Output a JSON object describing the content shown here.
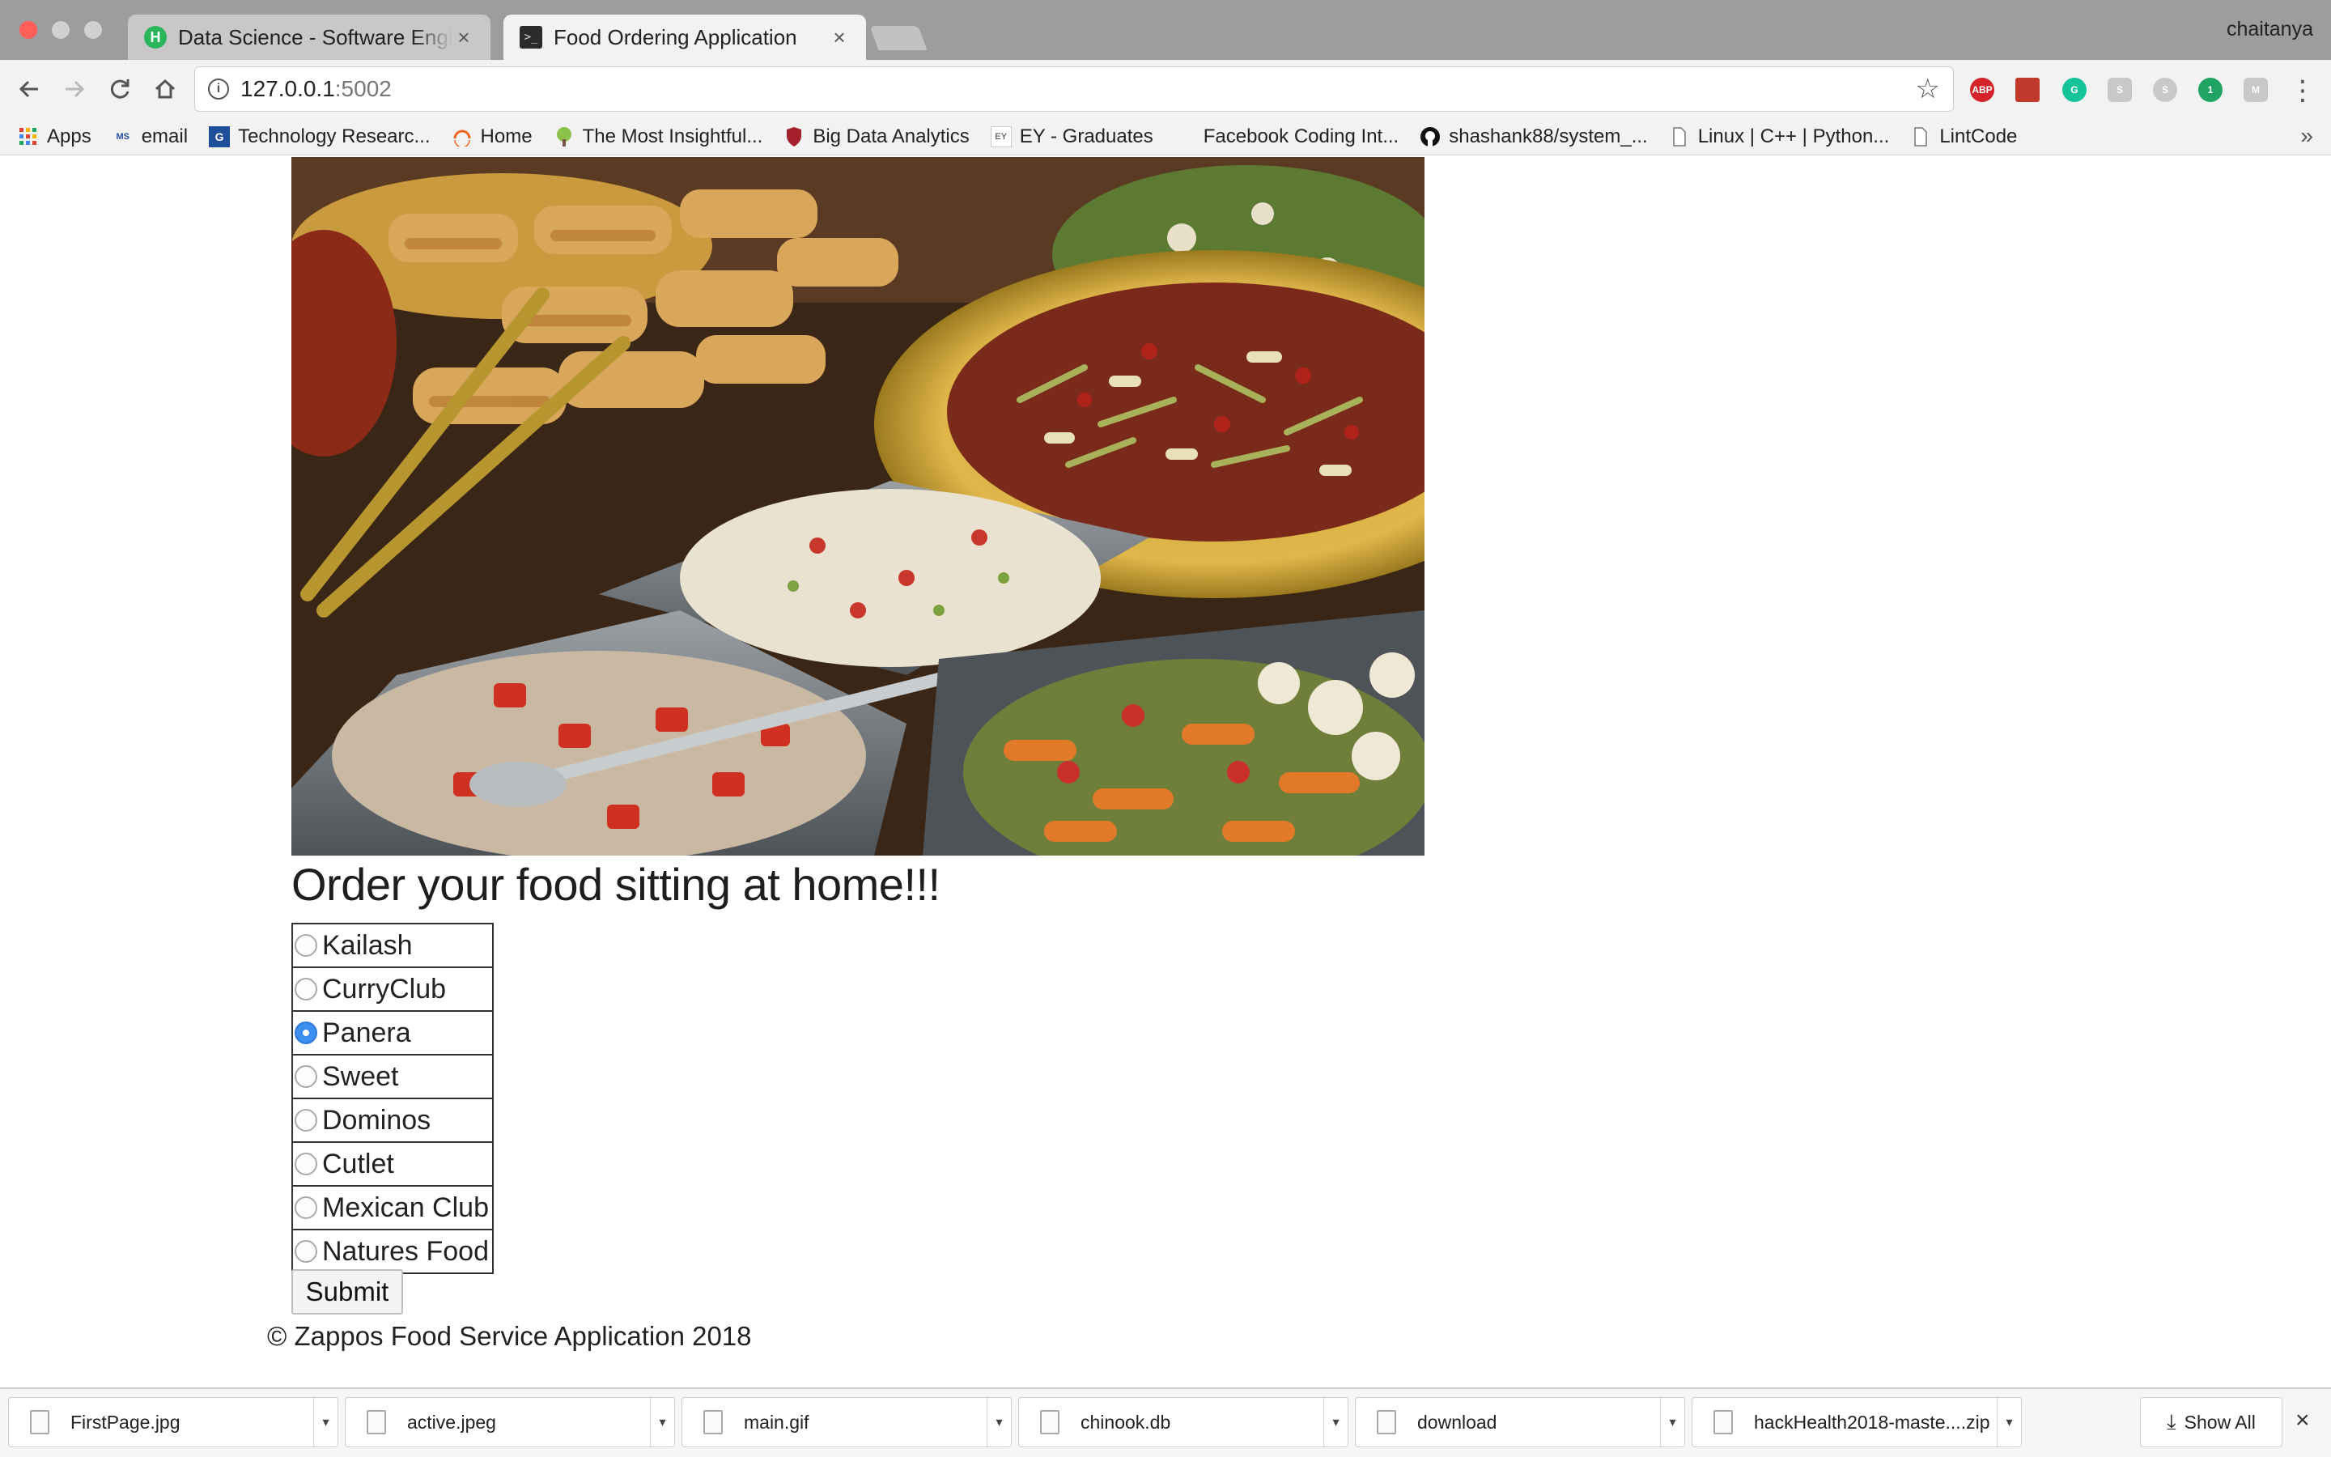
{
  "browser": {
    "tabs": [
      {
        "title": "Data Science - Software Engin",
        "favicon": "H"
      },
      {
        "title": "Food Ordering Application",
        "favicon": ">_"
      }
    ],
    "profile_name": "chaitanya",
    "tab_close_glyph": "×",
    "url_host": "127.0.0.1",
    "url_port": ":5002",
    "info_glyph": "i",
    "extensions": [
      {
        "label": "ABP",
        "color": "#d4232a"
      },
      {
        "label": "",
        "color": "#c0392b"
      },
      {
        "label": "G",
        "color": "#15c39a"
      },
      {
        "label": "S",
        "color": "#c8c8c8"
      },
      {
        "label": "S",
        "color": "#c8c8c8"
      },
      {
        "label": "1",
        "color": "#1fa463"
      },
      {
        "label": "M",
        "color": "#c8c8c8"
      }
    ]
  },
  "bookmarks": [
    {
      "label": "Apps",
      "icon": "apps-grid-icon"
    },
    {
      "label": "email",
      "icon": "email-icon"
    },
    {
      "label": "Technology Researc...",
      "icon": "technology-icon"
    },
    {
      "label": "Home",
      "icon": "home-icon"
    },
    {
      "label": "The Most Insightful...",
      "icon": "tree-icon"
    },
    {
      "label": "Big Data Analytics",
      "icon": "shield-icon"
    },
    {
      "label": "EY - Graduates",
      "icon": "ey-icon"
    },
    {
      "label": "Facebook Coding Int...",
      "icon": "facebook-icon"
    },
    {
      "label": "shashank88/system_...",
      "icon": "github-icon"
    },
    {
      "label": "Linux | C++ | Python...",
      "icon": "page-icon"
    },
    {
      "label": "LintCode",
      "icon": "page-icon"
    }
  ],
  "page": {
    "heading": "Order your food sitting at home!!!",
    "restaurants": [
      {
        "name": "Kailash",
        "checked": false
      },
      {
        "name": "CurryClub",
        "checked": false
      },
      {
        "name": "Panera",
        "checked": true
      },
      {
        "name": "Sweet",
        "checked": false
      },
      {
        "name": "Dominos",
        "checked": false
      },
      {
        "name": "Cutlet",
        "checked": false
      },
      {
        "name": "Mexican Club",
        "checked": false
      },
      {
        "name": "Natures Food",
        "checked": false
      }
    ],
    "submit_label": "Submit",
    "footer": "© Zappos Food Service Application 2018"
  },
  "downloads": {
    "items": [
      "FirstPage.jpg",
      "active.jpeg",
      "main.gif",
      "chinook.db",
      "download",
      "hackHealth2018-maste....zip"
    ],
    "show_all_label": "Show All",
    "caret_glyph": "▾",
    "close_glyph": "×"
  }
}
